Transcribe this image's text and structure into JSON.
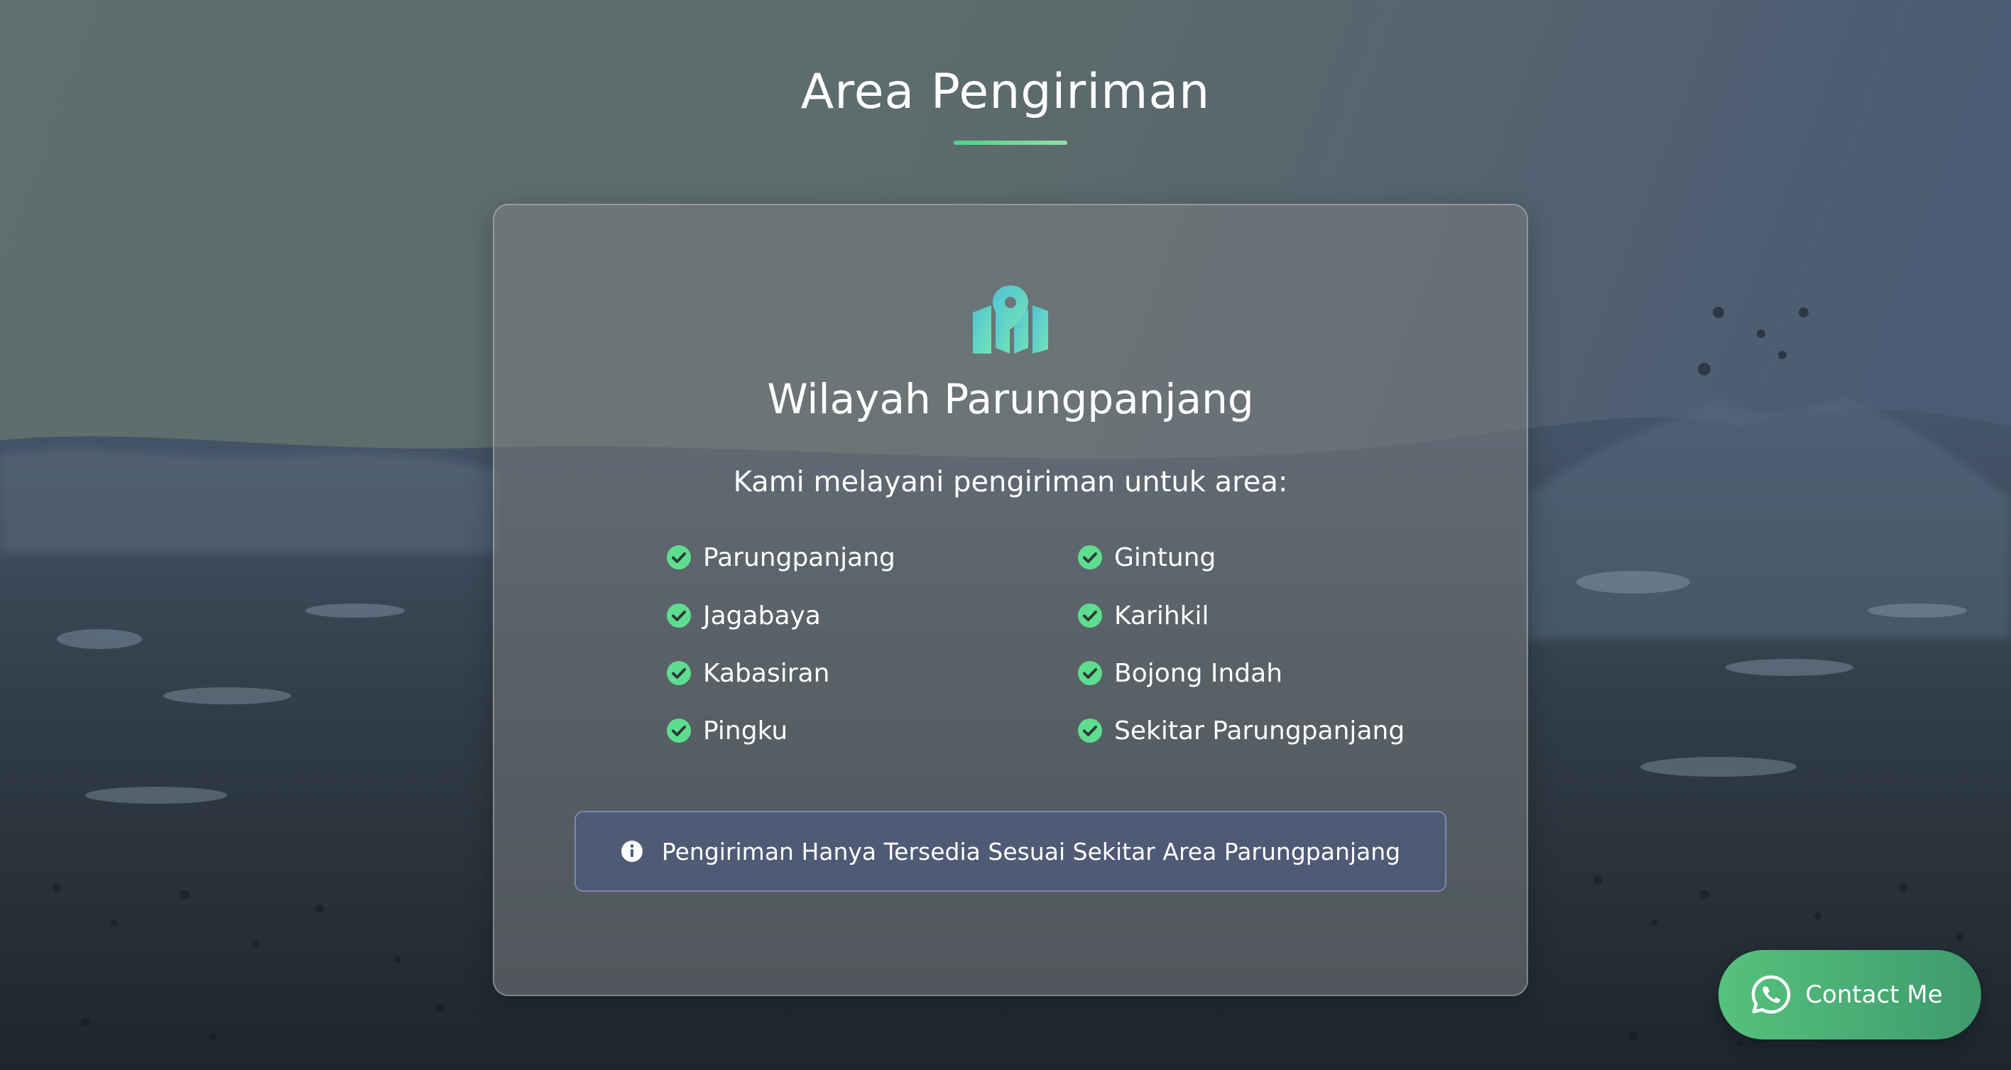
{
  "section": {
    "title": "Area Pengiriman"
  },
  "card": {
    "icon": "map-marker-icon",
    "title": "Wilayah Parungpanjang",
    "subtitle": "Kami melayani pengiriman untuk area:",
    "areas": [
      "Parungpanjang",
      "Gintung",
      "Jagabaya",
      "Karihkil",
      "Kabasiran",
      "Bojong Indah",
      "Pingku",
      "Sekitar Parungpanjang"
    ],
    "info": {
      "icon": "info-icon",
      "text": "Pengiriman Hanya Tersedia Sesuai Sekitar Area Parungpanjang"
    }
  },
  "contact": {
    "label": "Contact Me",
    "icon": "whatsapp-icon"
  },
  "colors": {
    "accent_green": "#4cd389",
    "icon_teal": "#5fd4c8",
    "button_green": "#4cb074"
  }
}
